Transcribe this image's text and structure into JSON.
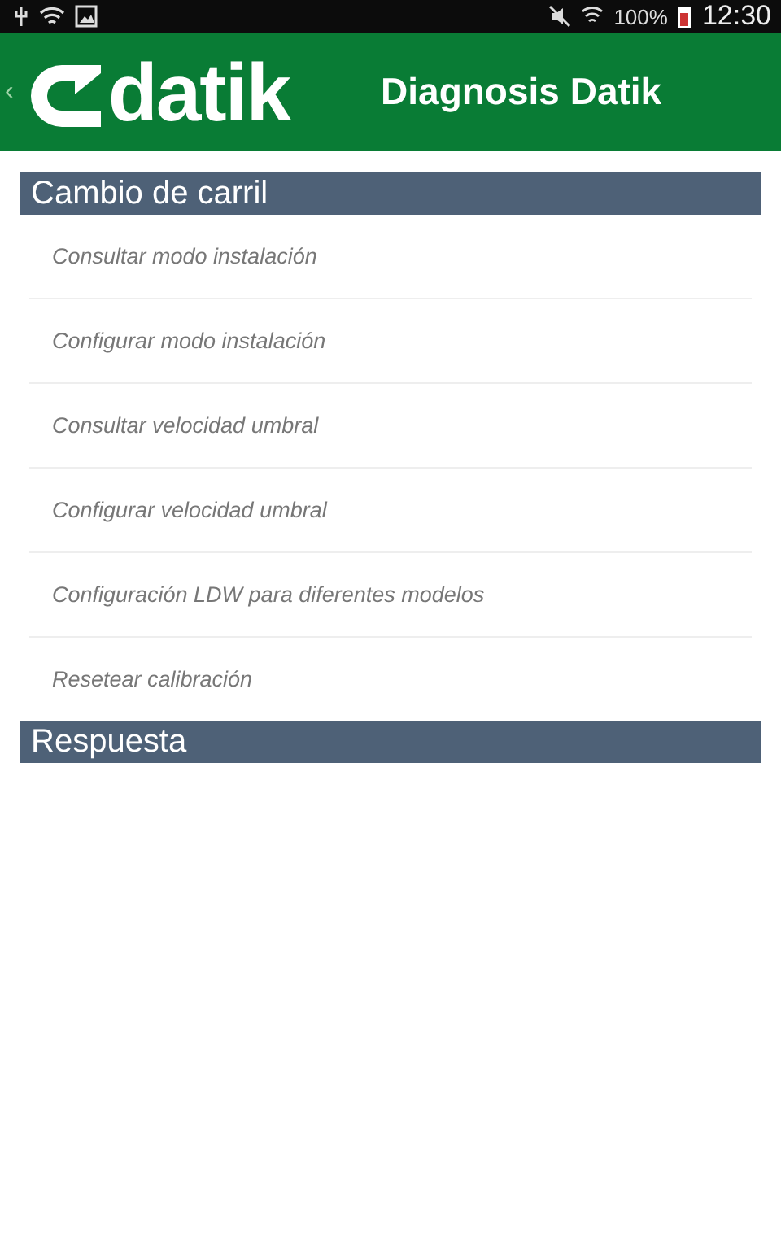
{
  "status_bar": {
    "battery": "100%",
    "time": "12:30"
  },
  "header": {
    "back": "‹",
    "logo": "datik",
    "title": "Diagnosis Datik"
  },
  "sections": [
    {
      "title": "Cambio de carril",
      "items": [
        {
          "label": "Consultar modo instalación"
        },
        {
          "label": "Configurar modo instalación"
        },
        {
          "label": "Consultar velocidad umbral"
        },
        {
          "label": "Configurar velocidad umbral"
        },
        {
          "label": "Configuración LDW para diferentes modelos"
        },
        {
          "label": "Resetear calibración"
        }
      ]
    },
    {
      "title": "Respuesta"
    }
  ]
}
